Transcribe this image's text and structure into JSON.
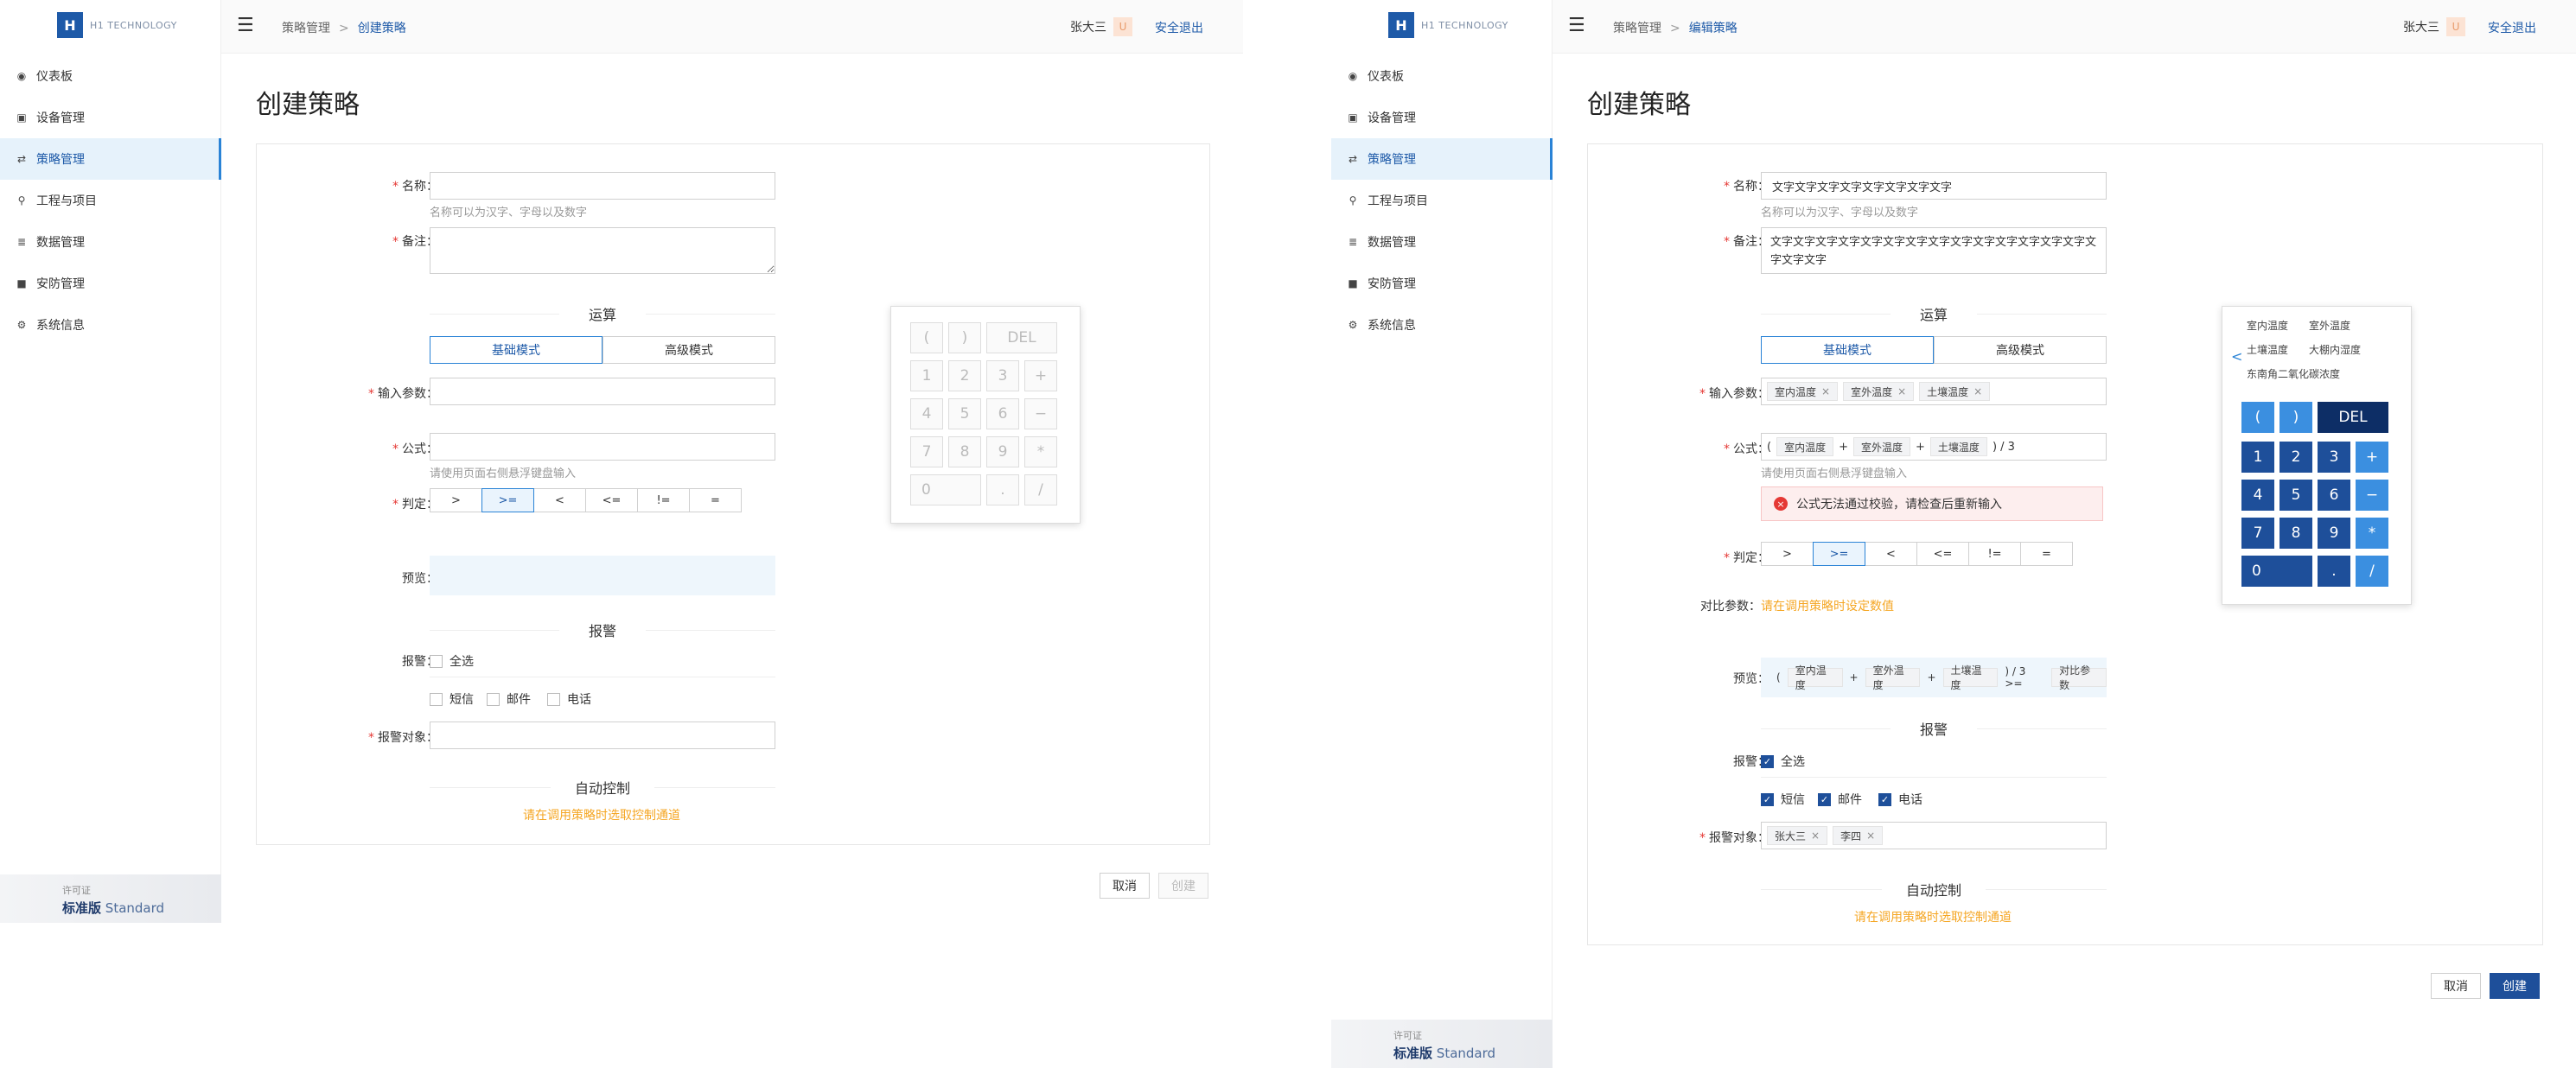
{
  "common": {
    "logo_text": "H1 TECHNOLOGY",
    "nav": [
      {
        "label": "仪表板",
        "icon": "dashboard-icon"
      },
      {
        "label": "设备管理",
        "icon": "lock-icon"
      },
      {
        "label": "策略管理",
        "icon": "strategy-icon"
      },
      {
        "label": "工程与项目",
        "icon": "project-icon"
      },
      {
        "label": "数据管理",
        "icon": "data-icon"
      },
      {
        "label": "安防管理",
        "icon": "security-icon"
      },
      {
        "label": "系统信息",
        "icon": "gear-icon"
      }
    ],
    "license_title": "许可证",
    "license_name": "标准版",
    "license_name_en": "Standard",
    "user_name": "张大三",
    "user_avatar": "U",
    "logout": "安全退出",
    "breadcrumb_root": "策略管理",
    "breadcrumb_sep": ">",
    "labels": {
      "name": "名称：",
      "remark": "备注：",
      "name_hint": "名称可以为汉字、字母以及数字",
      "section_calc": "运算",
      "mode_basic": "基础模式",
      "mode_advanced": "高级模式",
      "input_params": "输入参数：",
      "formula": "公式：",
      "formula_hint": "请使用页面右侧悬浮键盘输入",
      "judge": "判定：",
      "compare": "对比参数：",
      "compare_hint": "请在调用策略时设定数值",
      "preview": "预览：",
      "section_alarm": "报警",
      "alarm": "报警：",
      "all": "全选",
      "sms": "短信",
      "mail": "邮件",
      "phone": "电话",
      "alarm_target": "报警对象：",
      "section_auto": "自动控制",
      "auto_hint": "请在调用策略时选取控制通道",
      "cancel": "取消",
      "create": "创建"
    },
    "operators": [
      ">",
      ">=",
      "<",
      "<=",
      "!=",
      "="
    ],
    "selected_operator": ">=",
    "keys": {
      "lparen": "(",
      "rparen": ")",
      "del": "DEL",
      "k1": "1",
      "k2": "2",
      "k3": "3",
      "plus": "+",
      "k4": "4",
      "k5": "5",
      "k6": "6",
      "minus": "−",
      "k7": "7",
      "k8": "8",
      "k9": "9",
      "mul": "*",
      "k0": "0",
      "dot": ".",
      "div": "/"
    }
  },
  "left": {
    "breadcrumb_current": "创建策略",
    "page_title": "创建策略"
  },
  "right": {
    "breadcrumb_current": "编辑策略",
    "page_title": "创建策略",
    "name_value": "文字文字文字文字文字文字文字文字",
    "remark_value": "文字文字文字文字文字文字文字文字文字文字文字文字文字文字文字文字文字",
    "input_tags": [
      "室内温度",
      "室外温度",
      "土壤温度"
    ],
    "formula": {
      "open": "(",
      "t1": "室内温度",
      "op1": "+",
      "t2": "室外温度",
      "op2": "+",
      "t3": "土壤温度",
      "tail": ") / 3"
    },
    "error_msg": "公式无法通过校验，请检查后重新输入",
    "preview": {
      "open": "(",
      "t1": "室内温度",
      "op1": "+",
      "t2": "室外温度",
      "op2": "+",
      "t3": "土壤温度",
      "tail": ") / 3 >=",
      "cmp": "对比参数"
    },
    "alarm_targets": [
      "张大三",
      "李四"
    ],
    "param_options": [
      "室内温度",
      "室外温度",
      "土壤温度",
      "大棚内湿度",
      "东南角二氧化碳浓度"
    ],
    "param_arrow": "<"
  }
}
